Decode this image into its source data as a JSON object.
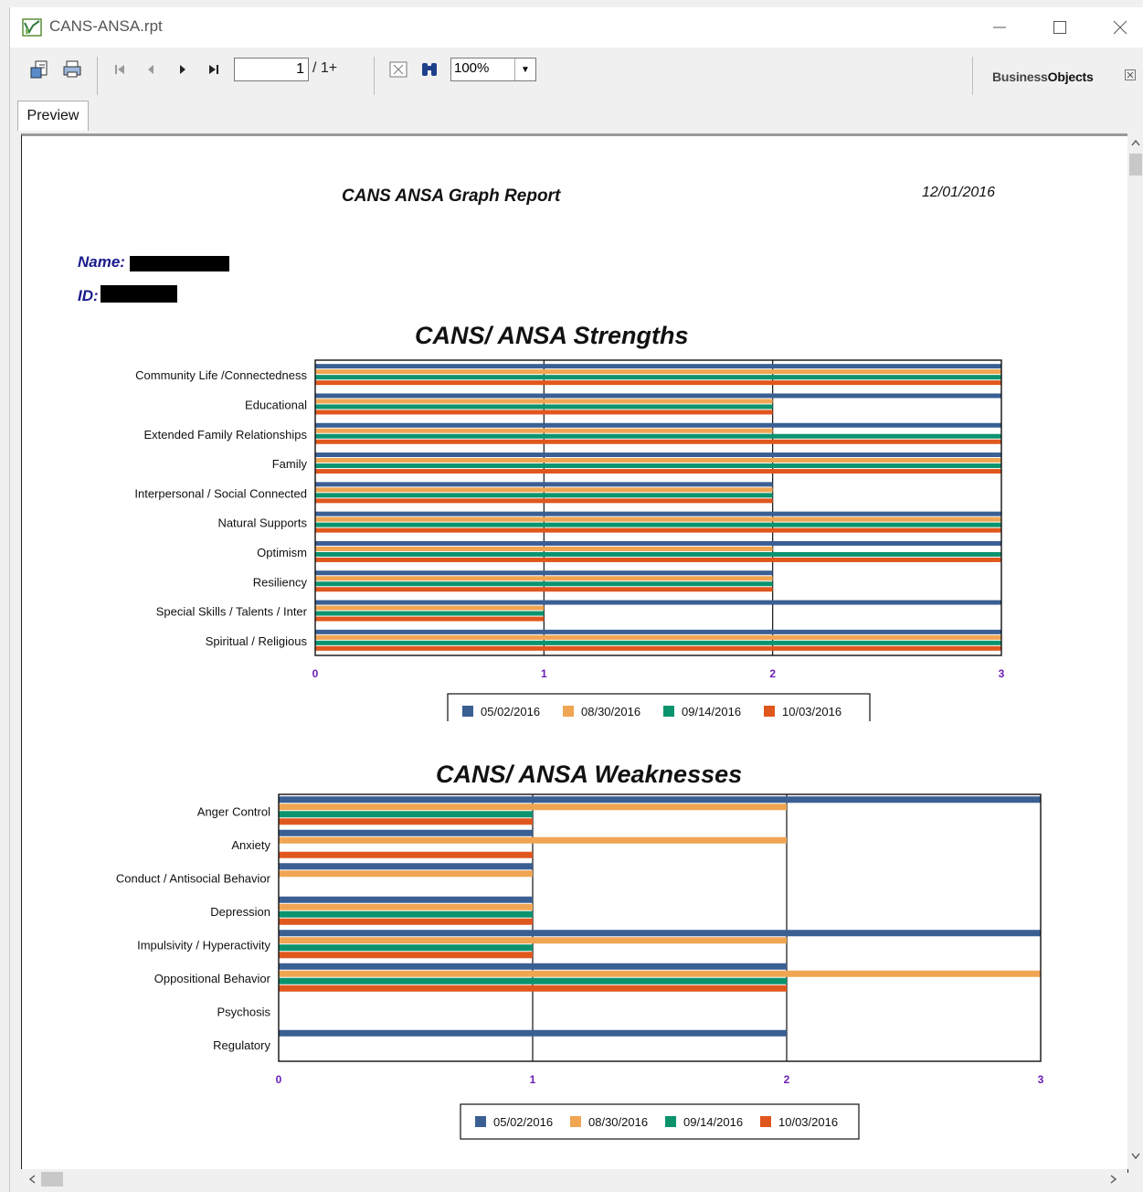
{
  "window": {
    "title": "CANS-ANSA.rpt"
  },
  "toolbar": {
    "page_number": "1",
    "page_total": "/ 1+",
    "zoom": "100%",
    "brand": {
      "prefix": "Business",
      "suffix": "Objects"
    }
  },
  "tabs": [
    {
      "label": "Preview"
    }
  ],
  "report": {
    "title": "CANS ANSA  Graph Report",
    "date": "12/01/2016",
    "name_label": "Name:",
    "id_label": "ID:"
  },
  "colors": {
    "series1": "#3a5f93",
    "series2": "#f0a553",
    "series3": "#0b936e",
    "series4": "#e0571e"
  },
  "chart_data": [
    {
      "type": "bar",
      "orientation": "horizontal",
      "title": "CANS/ ANSA Strengths",
      "categories": [
        "Community Life /Connectedness",
        "Educational",
        "Extended Family Relationships",
        "Family",
        "Interpersonal / Social Connected",
        "Natural Supports",
        "Optimism",
        "Resiliency",
        "Special Skills / Talents / Inter",
        "Spiritual / Religious"
      ],
      "series": [
        {
          "name": "05/02/2016",
          "values": [
            3,
            3,
            3,
            3,
            2,
            3,
            3,
            2,
            3,
            3
          ]
        },
        {
          "name": "08/30/2016",
          "values": [
            3,
            2,
            2,
            3,
            2,
            3,
            2,
            2,
            1,
            3
          ]
        },
        {
          "name": "09/14/2016",
          "values": [
            3,
            2,
            3,
            3,
            2,
            3,
            3,
            2,
            1,
            3
          ]
        },
        {
          "name": "10/03/2016",
          "values": [
            3,
            2,
            3,
            3,
            2,
            3,
            3,
            2,
            1,
            3
          ]
        }
      ],
      "xlim": [
        0,
        3
      ],
      "ticks": [
        "0",
        "1",
        "2",
        "3"
      ],
      "grid": true,
      "legend": "bottom"
    },
    {
      "type": "bar",
      "orientation": "horizontal",
      "title": "CANS/ ANSA Weaknesses",
      "categories": [
        "Anger Control",
        "Anxiety",
        "Conduct / Antisocial Behavior",
        "Depression",
        "Impulsivity / Hyperactivity",
        "Oppositional Behavior",
        "Psychosis",
        "Regulatory"
      ],
      "series": [
        {
          "name": "05/02/2016",
          "values": [
            3,
            1,
            1,
            1,
            3,
            2,
            0,
            2
          ]
        },
        {
          "name": "08/30/2016",
          "values": [
            2,
            2,
            1,
            1,
            2,
            3,
            0,
            0
          ]
        },
        {
          "name": "09/14/2016",
          "values": [
            1,
            0,
            0,
            1,
            1,
            2,
            0,
            0
          ]
        },
        {
          "name": "10/03/2016",
          "values": [
            1,
            1,
            0,
            1,
            1,
            2,
            0,
            0
          ]
        }
      ],
      "xlim": [
        0,
        3
      ],
      "ticks": [
        "0",
        "1",
        "2",
        "3"
      ],
      "grid": true,
      "legend": "bottom"
    }
  ]
}
